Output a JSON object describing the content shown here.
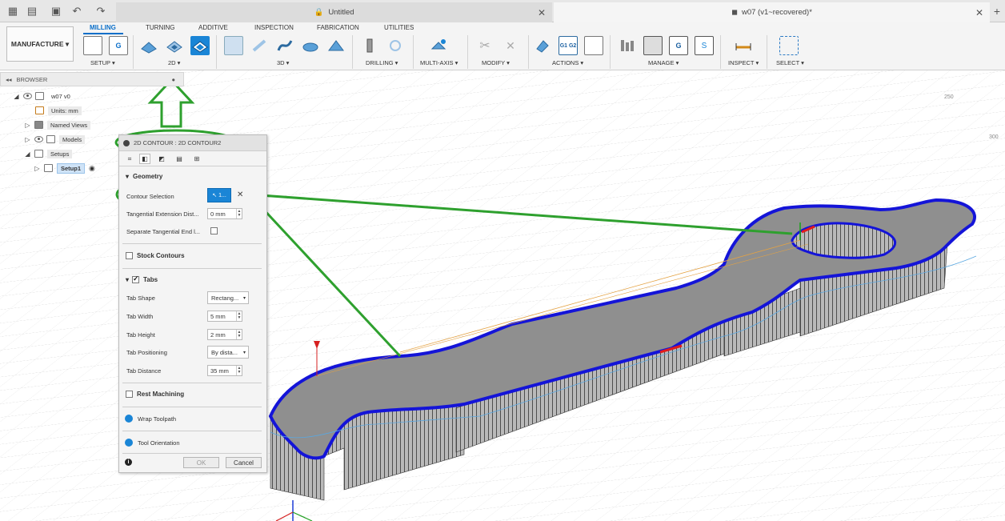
{
  "window": {
    "tabs": [
      {
        "label": "Untitled"
      },
      {
        "label": "w07 (v1~recovered)*"
      }
    ]
  },
  "ribbon": {
    "workspace": "MANUFACTURE",
    "tabs": [
      "MILLING",
      "TURNING",
      "ADDITIVE",
      "INSPECTION",
      "FABRICATION",
      "UTILITIES"
    ],
    "groups": [
      "SETUP",
      "2D",
      "3D",
      "DRILLING",
      "MULTI-AXIS",
      "MODIFY",
      "ACTIONS",
      "MANAGE",
      "INSPECT",
      "SELECT"
    ],
    "g1g2_label": "G1 G2",
    "nc_label": "G"
  },
  "browser": {
    "header": "BROWSER",
    "items": [
      {
        "label": "w07 v0"
      },
      {
        "label": "Units: mm"
      },
      {
        "label": "Named Views"
      },
      {
        "label": "Models"
      },
      {
        "label": "Setups"
      },
      {
        "label": "Setup1"
      }
    ]
  },
  "dialog": {
    "title": "2D CONTOUR : 2D CONTOUR2",
    "geometry": {
      "header": "Geometry",
      "contour_selection_label": "Contour Selection",
      "contour_selection_value": "1...",
      "tangential_label": "Tangential Extension Dist...",
      "tangential_value": "0 mm",
      "separate_label": "Separate Tangential End l..."
    },
    "stock_contours": "Stock Contours",
    "tabs": {
      "header": "Tabs",
      "shape_label": "Tab Shape",
      "shape_value": "Rectang...",
      "width_label": "Tab Width",
      "width_value": "5 mm",
      "height_label": "Tab Height",
      "height_value": "2 mm",
      "positioning_label": "Tab Positioning",
      "positioning_value": "By dista...",
      "distance_label": "Tab Distance",
      "distance_value": "35 mm"
    },
    "rest_machining": "Rest Machining",
    "wrap_toolpath": "Wrap Toolpath",
    "tool_orientation": "Tool Orientation",
    "ok": "OK",
    "cancel": "Cancel"
  },
  "viewport": {
    "axis_labels": [
      "250",
      "300"
    ]
  },
  "colors": {
    "accent": "#0b6fc9",
    "highlight_green": "#2ea02e",
    "contour_blue": "#1414d8"
  }
}
